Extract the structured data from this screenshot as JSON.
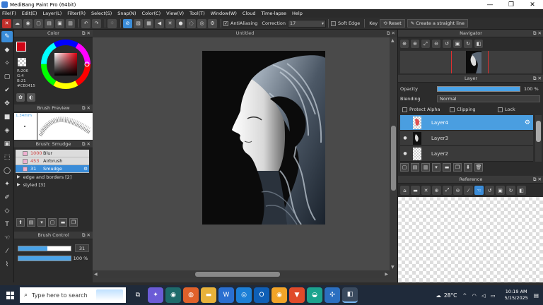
{
  "window": {
    "title": "MediBang Paint Pro (64bit)",
    "controls": [
      "—",
      "❐",
      "✕"
    ]
  },
  "menu": [
    "File(F)",
    "Edit(E)",
    "Layer(L)",
    "Filter(R)",
    "Select(S)",
    "Snap(N)",
    "Color(C)",
    "View(V)",
    "Tool(T)",
    "Window(W)",
    "Cloud",
    "Time-lapse",
    "Help"
  ],
  "toolbar": {
    "antialiasing_label": "AntiAliasing",
    "correction_label": "Correction",
    "correction_value": "17",
    "soft_edge_label": "Soft Edge",
    "key_label": "Key",
    "reset_label": "Reset",
    "straight_line_label": "Create a straight line"
  },
  "color_panel": {
    "title": "Color",
    "foreground": "#CE0415",
    "rgb_r": "R:206",
    "rgb_g": "G:4",
    "rgb_b": "B:21",
    "hex": "#CE0415"
  },
  "brush_preview": {
    "title": "Brush Preview",
    "size": "1.34mm"
  },
  "brush_panel": {
    "title": "Brush: Smudge",
    "items": [
      {
        "num": "1000",
        "name": "Blur"
      },
      {
        "num": "453",
        "name": "Airbrush"
      },
      {
        "num": "31",
        "name": "Smudge"
      }
    ],
    "groups": [
      "edge and borders [2]",
      "styled [3]"
    ]
  },
  "brush_control": {
    "title": "Brush Control",
    "size_value": "31",
    "opacity_value": "100 %",
    "size_fraction": 0.55,
    "opacity_fraction": 1.0
  },
  "canvas": {
    "title": "Untitled"
  },
  "navigator": {
    "title": "Navigator"
  },
  "layer_panel": {
    "title": "Layer",
    "opacity_label": "Opacity",
    "opacity_value": "100 %",
    "blending_label": "Blending",
    "blending_value": "Normal",
    "protect_alpha": "Protect Alpha",
    "clipping": "Clipping",
    "lock": "Lock",
    "layers": [
      "Layer4",
      "Layer3",
      "Layer2"
    ]
  },
  "reference": {
    "title": "Reference"
  },
  "taskbar": {
    "search_placeholder": "Type here to search",
    "temperature": "28°C",
    "time": "10:19 AM",
    "date": "5/15/2025"
  }
}
